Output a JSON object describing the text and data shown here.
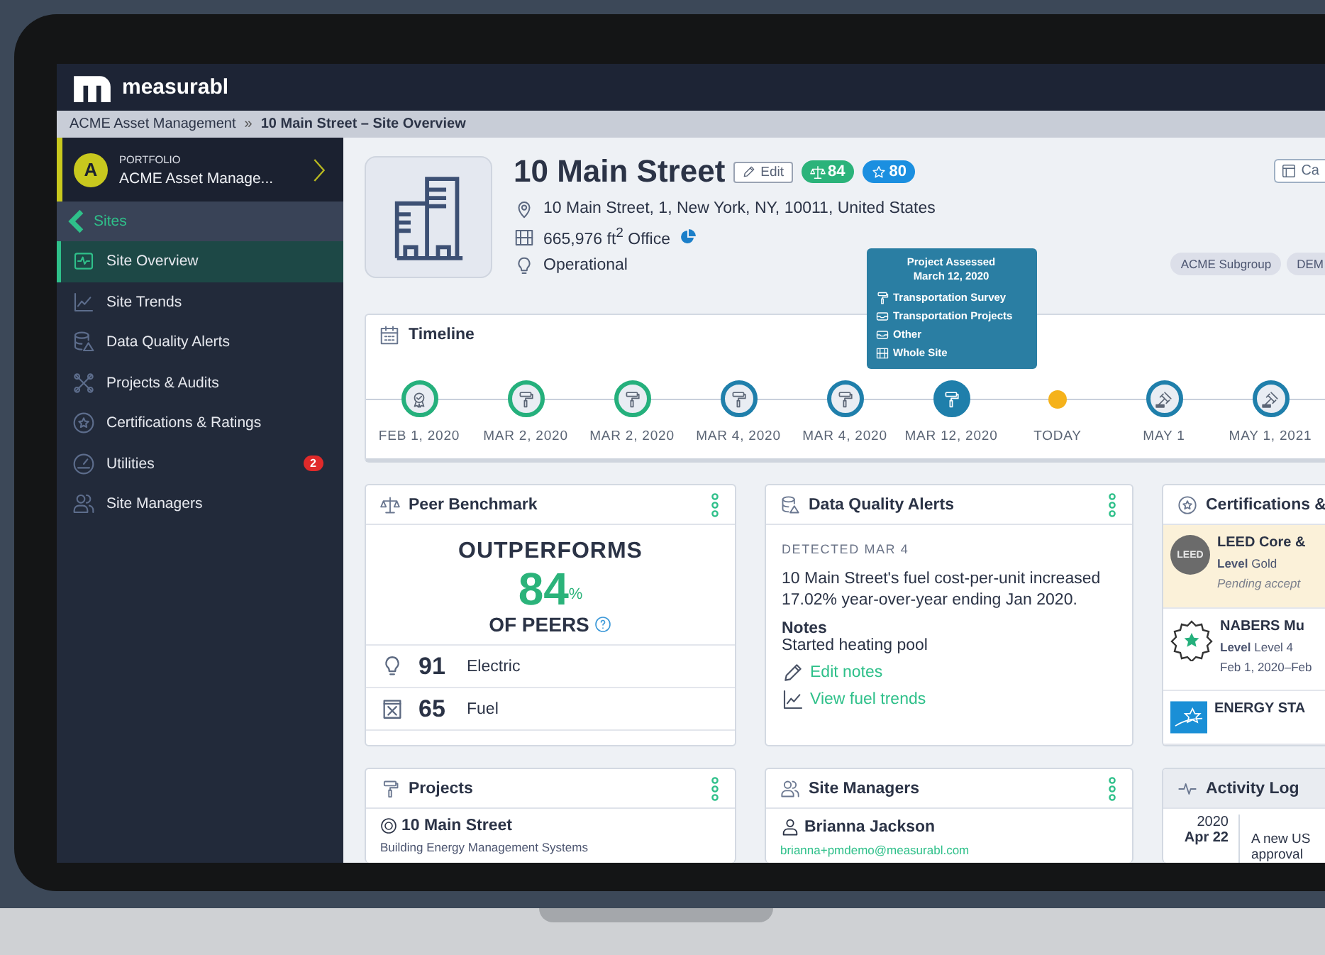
{
  "app": {
    "brand": "measurabl"
  },
  "breadcrumb": {
    "separator": "»",
    "items": [
      {
        "label": "ACME Asset Management"
      },
      {
        "label": "10 Main Street – Site Overview"
      }
    ]
  },
  "sidebar": {
    "portfolio": {
      "avatar": "A",
      "caption": "PORTFOLIO",
      "name": "ACME Asset Manage..."
    },
    "back": {
      "label": "Sites"
    },
    "items": [
      {
        "label": "Site Overview",
        "selected": true
      },
      {
        "label": "Site Trends",
        "selected": false
      },
      {
        "label": "Data Quality Alerts",
        "selected": false
      },
      {
        "label": "Projects & Audits",
        "selected": false
      },
      {
        "label": "Certifications & Ratings",
        "selected": false
      },
      {
        "label": "Utilities",
        "selected": false,
        "badge": "2"
      },
      {
        "label": "Site Managers",
        "selected": false
      }
    ]
  },
  "site": {
    "title": "10 Main Street",
    "edit": "Edit",
    "badges": [
      {
        "kind": "benchmark",
        "value": "84",
        "color": "#2bb37a"
      },
      {
        "kind": "star",
        "value": "80",
        "color": "#1b8fe0"
      }
    ],
    "details": [
      "10 Main Street, 1, New York, NY, 10011, United States",
      "665,976 ft$^{2}$ Office",
      "Operational"
    ],
    "action": "Ca",
    "tags": [
      "ACME Subgroup",
      "DEM"
    ]
  },
  "timeline": {
    "title": "Timeline",
    "events": [
      {
        "label": "FEB 1, 2020",
        "kind": "certificate",
        "color": "#25b07c",
        "selected": false
      },
      {
        "label": "MAR 2, 2020",
        "kind": "project",
        "color": "#25b07c",
        "selected": false
      },
      {
        "label": "MAR 2, 2020",
        "kind": "project",
        "color": "#25b07c",
        "selected": false
      },
      {
        "label": "MAR 4, 2020",
        "kind": "project",
        "color": "#1f7fab",
        "selected": false
      },
      {
        "label": "MAR 4, 2020",
        "kind": "project",
        "color": "#1f7fab",
        "selected": false
      },
      {
        "label": "MAR 12, 2020",
        "kind": "project",
        "color": "#1f7fab",
        "selected": true
      },
      {
        "label": "TODAY",
        "kind": "today",
        "color": "#f5b21b",
        "selected": false
      },
      {
        "label": "MAY 1",
        "kind": "rating",
        "color": "#1f7fab",
        "selected": false
      },
      {
        "label": "MAY 1, 2021",
        "kind": "rating",
        "color": "#1f7fab",
        "selected": false
      }
    ],
    "tooltip": {
      "title": "Project Assessed",
      "date": "March 12, 2020",
      "items": [
        "Transportation Survey",
        "Transportation Projects",
        "Other",
        "Whole Site"
      ]
    }
  },
  "peer_benchmark": {
    "title": "Peer Benchmark",
    "headline": "OUTPERFORMS",
    "percent": "84",
    "percent_sign": "%",
    "caption": "OF PEERS",
    "rows": [
      {
        "score": "91",
        "label": "Electric"
      },
      {
        "score": "65",
        "label": "Fuel"
      }
    ]
  },
  "data_quality_alerts": {
    "title": "Data Quality Alerts",
    "detected": "DETECTED MAR 4",
    "message": "10 Main Street's fuel cost-per-unit increased 17.02% year-over-year ending Jan 2020.",
    "notes_label": "Notes",
    "notes": "Started heating pool",
    "links": [
      "Edit notes",
      "View fuel trends"
    ]
  },
  "certifications": {
    "title": "Certifications &",
    "items": [
      {
        "name": "LEED Core &",
        "logo_text": "LEED",
        "level_label": "Level",
        "level": "Gold",
        "note": "Pending accept",
        "pending": true
      },
      {
        "name": "NABERS Mu",
        "level_label": "Level",
        "level": "Level 4",
        "note": "Feb 1, 2020–Feb",
        "pending": false
      },
      {
        "name": "ENERGY STA",
        "pending": false
      }
    ]
  },
  "projects": {
    "title": "Projects",
    "items": [
      {
        "name": "10 Main Street",
        "description": "Building Energy Management Systems"
      }
    ]
  },
  "site_managers": {
    "title": "Site Managers",
    "people": [
      {
        "name": "Brianna Jackson",
        "email": "brianna+pmdemo@measurabl.com"
      }
    ]
  },
  "activity_log": {
    "title": "Activity Log",
    "entries": [
      {
        "year": "2020",
        "date": "Apr 22",
        "lines": [
          "A new US",
          "approval"
        ]
      }
    ]
  }
}
